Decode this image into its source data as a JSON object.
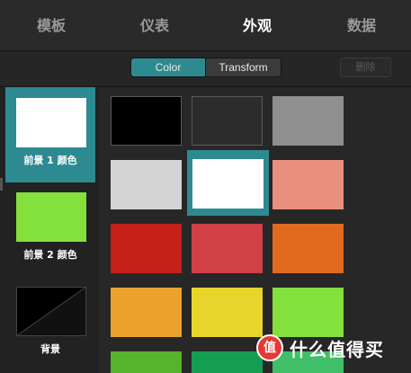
{
  "tabs": [
    {
      "label": "模板",
      "active": false
    },
    {
      "label": "仪表",
      "active": false
    },
    {
      "label": "外观",
      "active": true
    },
    {
      "label": "数据",
      "active": false
    }
  ],
  "toolbar": {
    "segment": [
      {
        "label": "Color",
        "active": true
      },
      {
        "label": "Transform",
        "active": false
      }
    ],
    "delete_label": "删除"
  },
  "sidebar": {
    "items": [
      {
        "label": "前景 1 颜色",
        "color": "#ffffff",
        "selected": true
      },
      {
        "label": "前景 2 颜色",
        "color": "#84e03c",
        "selected": false
      },
      {
        "label": "背景",
        "color": "#000000",
        "selected": false
      }
    ]
  },
  "palette": [
    {
      "color": "#000000",
      "selected": false
    },
    {
      "color": "#2c2c2c",
      "selected": false
    },
    {
      "color": "#8f8f8f",
      "selected": false
    },
    {
      "color": "#d4d4d4",
      "selected": false
    },
    {
      "color": "#ffffff",
      "selected": true
    },
    {
      "color": "#e98f7d",
      "selected": false
    },
    {
      "color": "#c41f18",
      "selected": false
    },
    {
      "color": "#d14045",
      "selected": false
    },
    {
      "color": "#e26a1f",
      "selected": false
    },
    {
      "color": "#eaa22c",
      "selected": false
    },
    {
      "color": "#e8d52b",
      "selected": false
    },
    {
      "color": "#84e03c",
      "selected": false
    },
    {
      "color": "#56b32a",
      "selected": false
    },
    {
      "color": "#159e51",
      "selected": false
    },
    {
      "color": "#3fbf68",
      "selected": false
    }
  ],
  "watermark": {
    "badge": "值",
    "text": "什么值得买"
  }
}
